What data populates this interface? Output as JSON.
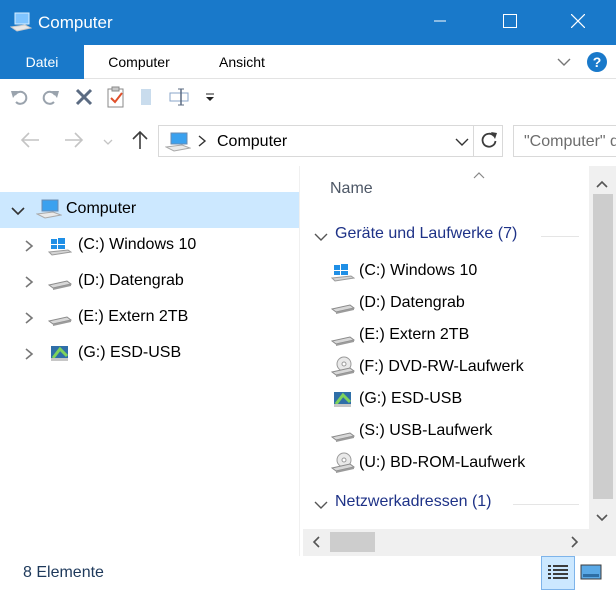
{
  "window": {
    "title": "Computer"
  },
  "ribbon": {
    "tabs": [
      {
        "label": "Datei",
        "active": true
      },
      {
        "label": "Computer",
        "active": false
      },
      {
        "label": "Ansicht",
        "active": false
      }
    ]
  },
  "address": {
    "crumb": "Computer",
    "search_placeholder": "\"Computer\" durchsuchen"
  },
  "nav": {
    "root": "Computer",
    "items": [
      {
        "label": "(C:) Windows 10",
        "icon": "windows-drive-icon"
      },
      {
        "label": "(D:) Datengrab",
        "icon": "hard-drive-icon"
      },
      {
        "label": "(E:) Extern 2TB",
        "icon": "hard-drive-icon"
      },
      {
        "label": "(G:) ESD-USB",
        "icon": "usb-setup-drive-icon"
      }
    ]
  },
  "content": {
    "column_name": "Name",
    "groups": [
      {
        "label": "Geräte und Laufwerke (7)",
        "items": [
          {
            "label": "(C:) Windows 10",
            "icon": "windows-drive-icon"
          },
          {
            "label": "(D:) Datengrab",
            "icon": "hard-drive-icon"
          },
          {
            "label": "(E:) Extern 2TB",
            "icon": "hard-drive-icon"
          },
          {
            "label": "(F:) DVD-RW-Laufwerk",
            "icon": "optical-drive-icon"
          },
          {
            "label": "(G:) ESD-USB",
            "icon": "usb-setup-drive-icon"
          },
          {
            "label": "(S:) USB-Laufwerk",
            "icon": "hard-drive-icon"
          },
          {
            "label": "(U:) BD-ROM-Laufwerk",
            "icon": "optical-drive-icon"
          }
        ]
      },
      {
        "label": "Netzwerkadressen (1)",
        "items": []
      }
    ]
  },
  "status": {
    "count": "8 Elemente"
  },
  "colors": {
    "titlebar": "#1979ca",
    "selection": "#cce8ff",
    "group_text": "#1e3287"
  }
}
